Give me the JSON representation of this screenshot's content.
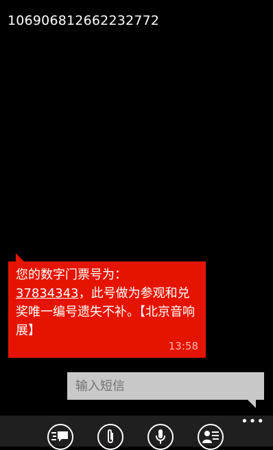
{
  "header": {
    "title": "106906812662232772"
  },
  "message": {
    "text_before": "您的数字门票号为：",
    "number": "37834343",
    "text_after": "，此号做为参观和兑奖唯一编号遗失不补。【北京音响展】",
    "time": "13:58"
  },
  "compose": {
    "placeholder": "输入短信"
  },
  "appbar": {
    "buttons": [
      {
        "icon": "switch-chat-icon"
      },
      {
        "icon": "attach-icon"
      },
      {
        "icon": "microphone-icon"
      },
      {
        "icon": "contact-card-icon"
      }
    ],
    "more_label": "•••"
  },
  "colors": {
    "accent": "#e51400",
    "background": "#000000",
    "compose_bg": "#c8c8c8",
    "appbar_bg": "#1f1f1f"
  }
}
